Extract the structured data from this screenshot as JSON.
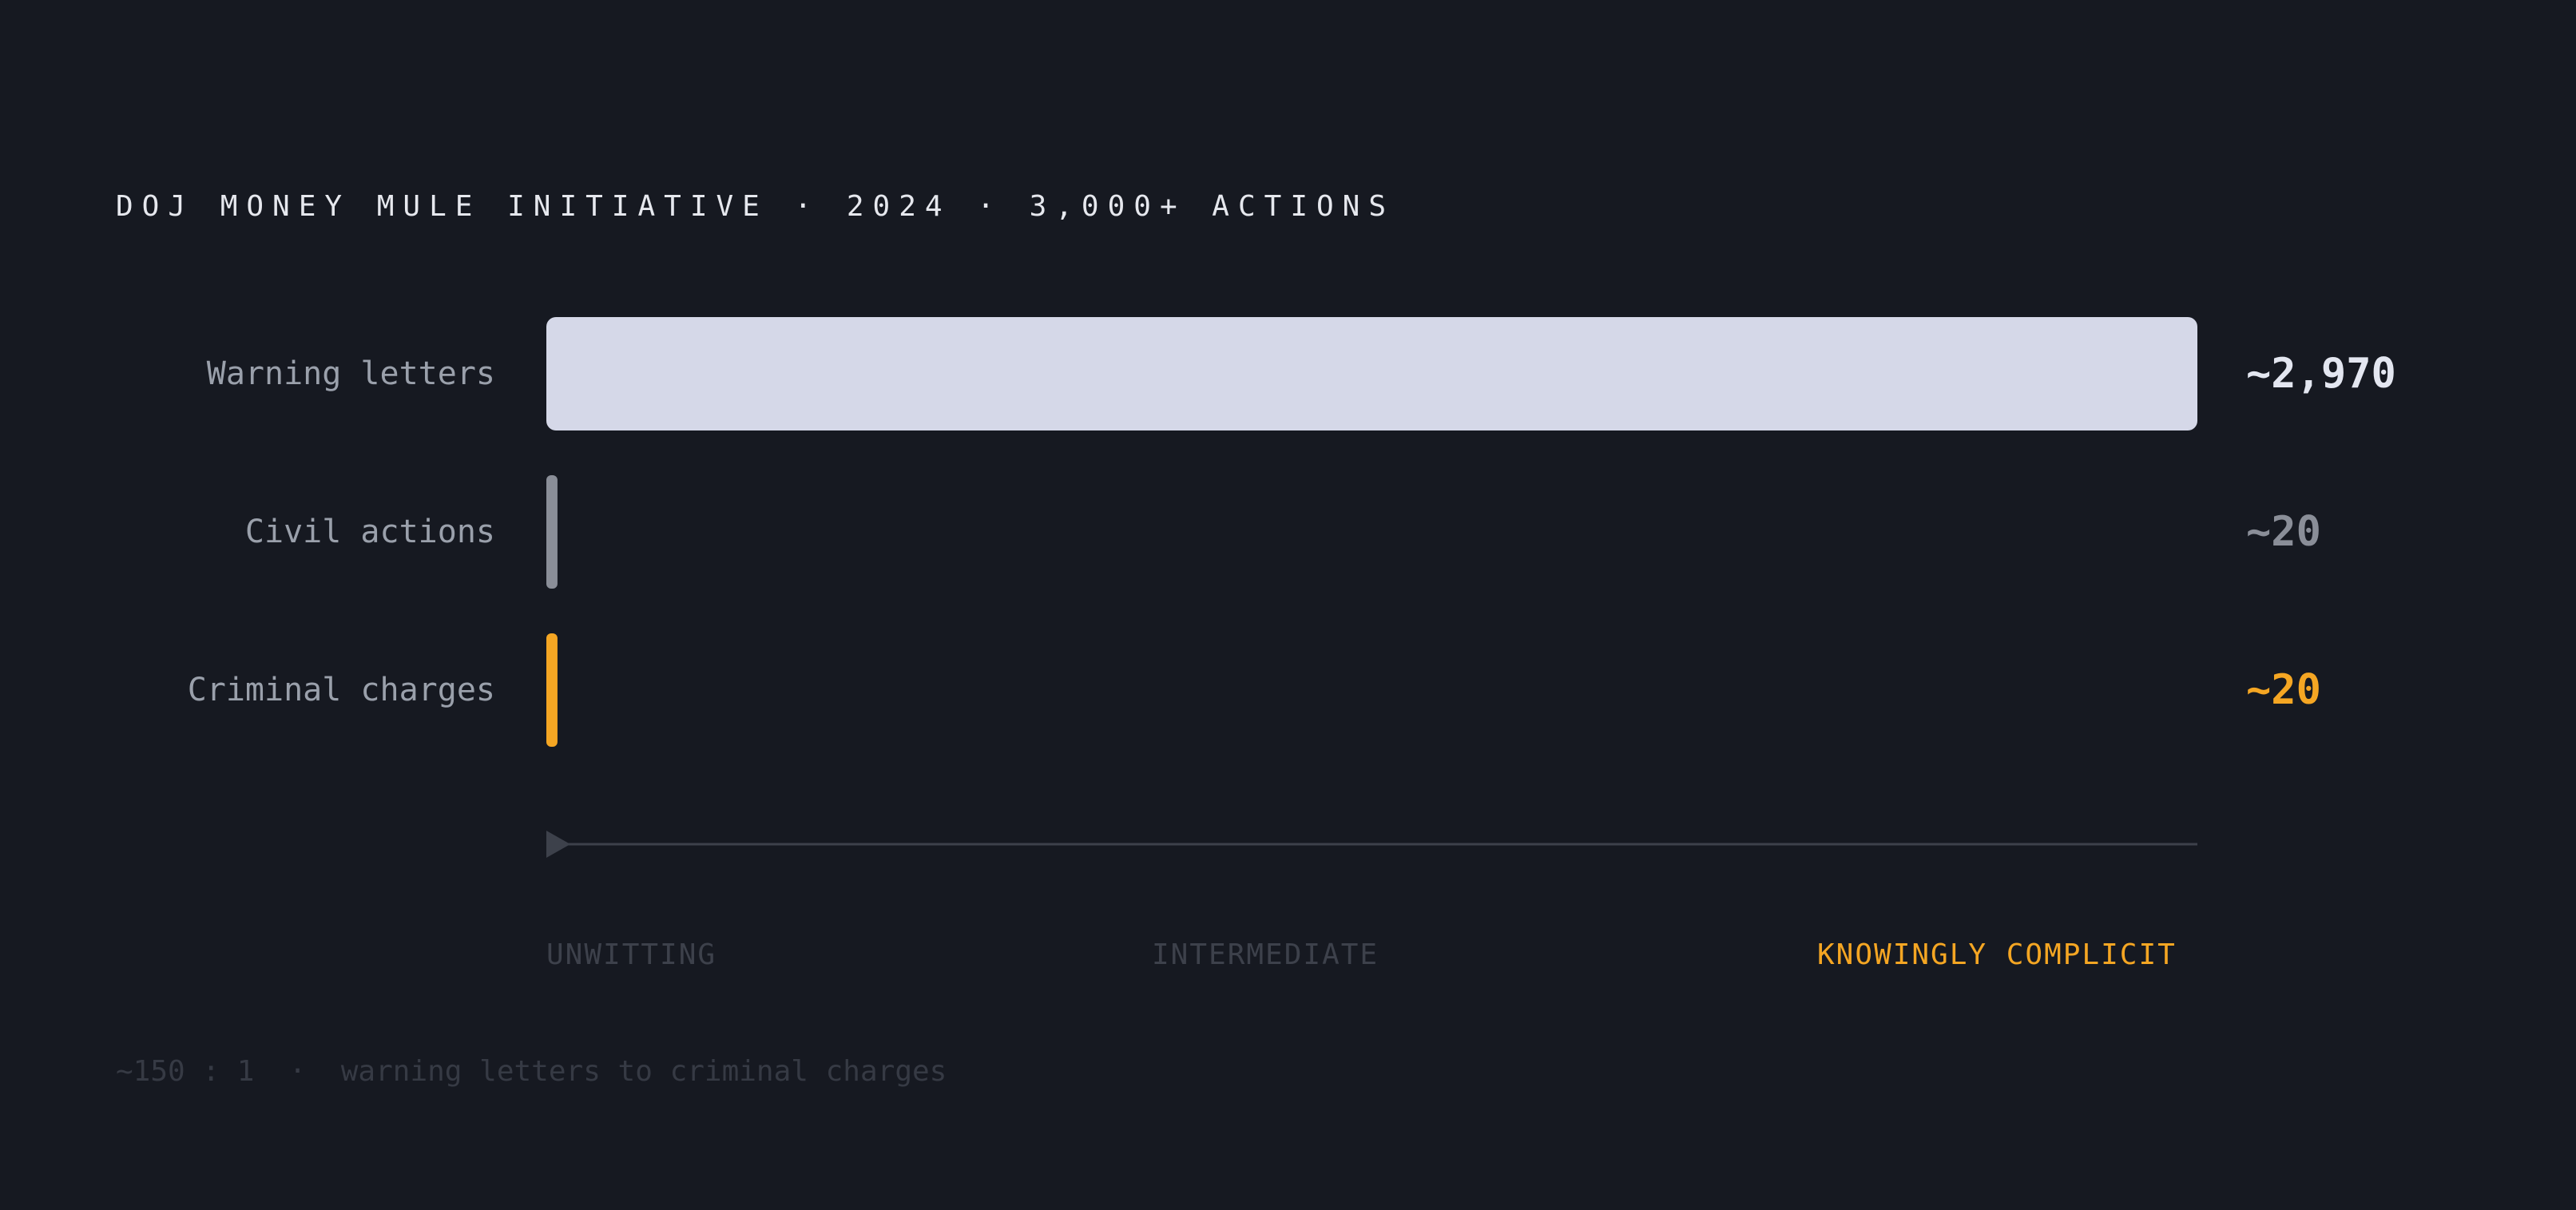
{
  "header": {
    "title": "DOJ MONEY MULE INITIATIVE · 2024 · 3,000+ ACTIONS"
  },
  "chart_data": {
    "type": "bar",
    "orientation": "horizontal",
    "categories": [
      "Warning letters",
      "Civil actions",
      "Criminal charges"
    ],
    "values": [
      2970,
      20,
      20
    ],
    "value_labels": [
      "~2,970",
      "~20",
      "~20"
    ],
    "colors": [
      "#d5d8e8",
      "#8a8e98",
      "#f5a623"
    ],
    "value_label_colors": [
      "#e3e6f0",
      "#8a8e98",
      "#f5a623"
    ],
    "xlim": [
      0,
      2970
    ],
    "grid": false,
    "legend": "none"
  },
  "scale": {
    "left": "UNWITTING",
    "middle": "INTERMEDIATE",
    "right": "KNOWINGLY COMPLICIT",
    "line_color": "#3d414b",
    "accent_color": "#f5a623"
  },
  "footnote": "~150 : 1  ·  warning letters to criminal charges"
}
